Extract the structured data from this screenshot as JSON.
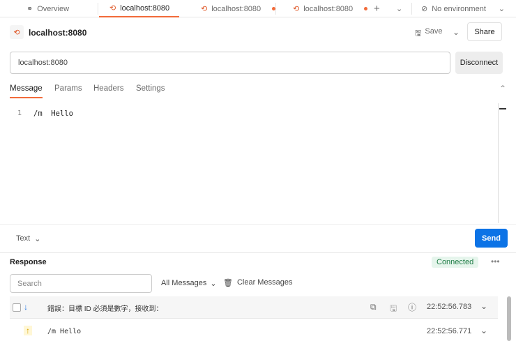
{
  "tabs": [
    {
      "label": "Overview"
    },
    {
      "label": "localhost:8080",
      "active": true
    },
    {
      "label": "localhost:8080"
    },
    {
      "label": "localhost:8080"
    }
  ],
  "environment": "No environment",
  "request": {
    "title": "localhost:8080",
    "save": "Save",
    "share": "Share",
    "url": "localhost:8080",
    "disconnect": "Disconnect"
  },
  "subtabs": [
    "Message",
    "Params",
    "Headers",
    "Settings"
  ],
  "editor": {
    "line": "1",
    "content": "/m  Hello"
  },
  "format": "Text",
  "send": "Send",
  "response": {
    "title": "Response",
    "status": "Connected",
    "search_placeholder": "Search",
    "filter": "All Messages",
    "clear": "Clear Messages",
    "messages": [
      {
        "direction": "incoming",
        "text": "錯誤：目標 ID 必須是數字，接收到：",
        "time": "22:52:56.783"
      },
      {
        "direction": "outgoing",
        "text": "/m Hello",
        "time": "22:52:56.771"
      }
    ]
  },
  "colors": {
    "accent": "#f26b3a",
    "send": "#0c73e6",
    "connected_bg": "#e6f5ec",
    "connected_text": "#1e7c45"
  }
}
